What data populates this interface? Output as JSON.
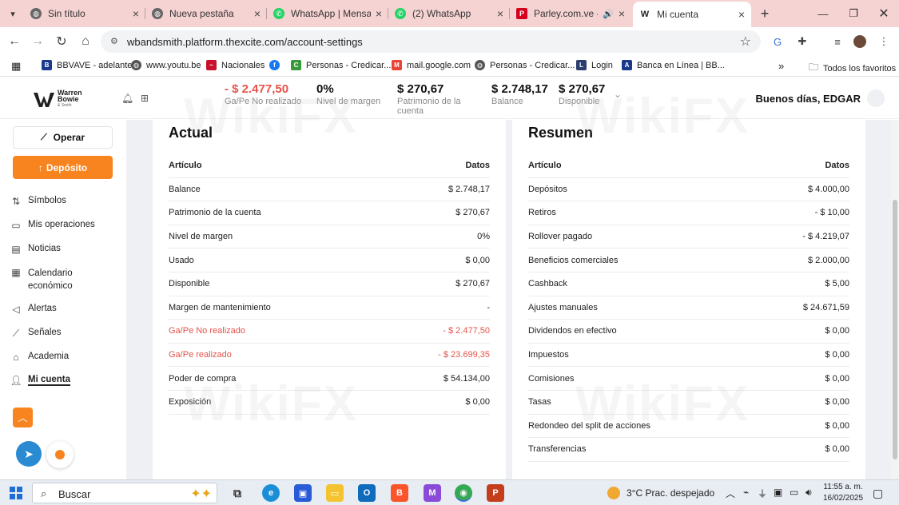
{
  "browser": {
    "tabs": [
      {
        "title": "Sin título",
        "icon": "globe-icon",
        "color": "#555555"
      },
      {
        "title": "Nueva pestaña",
        "icon": "globe-icon",
        "color": "#555555"
      },
      {
        "title": "WhatsApp | Mensaje",
        "icon": "whatsapp-icon",
        "color": "#25d366"
      },
      {
        "title": "(2) WhatsApp",
        "icon": "whatsapp-icon",
        "color": "#25d366"
      },
      {
        "title": "Parley.com.ve - El",
        "icon": "parley-icon",
        "color": "#d6001c"
      },
      {
        "title": "Mi cuenta",
        "icon": "warren-bowie-icon",
        "color": "#222222"
      }
    ],
    "url": "wbandsmith.platform.thexcite.com/account-settings",
    "bookmarks": [
      {
        "label": "BBVAVE - adelante"
      },
      {
        "label": "www.youtu.be"
      },
      {
        "label": "Nacionales"
      },
      {
        "label": ""
      },
      {
        "label": "Personas - Credicar..."
      },
      {
        "label": "mail.google.com"
      },
      {
        "label": "Personas - Credicar..."
      },
      {
        "label": "Login"
      },
      {
        "label": "Banca en Línea | BB..."
      }
    ],
    "all_bookmarks": "Todos los favoritos"
  },
  "header": {
    "brand": "Warren Bowie",
    "brand_sub": "& Smith",
    "metrics": [
      {
        "value": "- $ 2.477,50",
        "label": "Ga/Pe No realizado",
        "negative": true
      },
      {
        "value": "0%",
        "label": "Nivel de margen",
        "negative": false
      },
      {
        "value": "$ 270,67",
        "label": "Patrimonio de la cuenta",
        "negative": false
      },
      {
        "value": "$ 2.748,17",
        "label": "Balance",
        "negative": false
      },
      {
        "value": "$ 270,67",
        "label": "Disponible",
        "negative": false
      }
    ],
    "greeting": "Buenos días, EDGAR"
  },
  "sidebar": {
    "operar": "Operar",
    "deposito": "Depósito",
    "items": [
      {
        "label": "Símbolos",
        "icon": "sort-arrows-icon"
      },
      {
        "label": "Mis operaciones",
        "icon": "briefcase-icon"
      },
      {
        "label": "Noticias",
        "icon": "newspaper-icon"
      },
      {
        "label": "Calendario económico",
        "icon": "calendar-icon"
      },
      {
        "label": "Alertas",
        "icon": "megaphone-icon"
      },
      {
        "label": "Señales",
        "icon": "signal-icon"
      },
      {
        "label": "Academia",
        "icon": "graduation-cap-icon"
      },
      {
        "label": "Mi cuenta",
        "icon": "user-icon"
      }
    ]
  },
  "actual": {
    "title": "Actual",
    "col_item": "Artículo",
    "col_data": "Datos",
    "rows": [
      {
        "label": "Balance",
        "value": "$ 2.748,17",
        "red": false
      },
      {
        "label": "Patrimonio de la cuenta",
        "value": "$ 270,67",
        "red": false
      },
      {
        "label": "Nivel de margen",
        "value": "0%",
        "red": false
      },
      {
        "label": "Usado",
        "value": "$ 0,00",
        "red": false
      },
      {
        "label": "Disponible",
        "value": "$ 270,67",
        "red": false
      },
      {
        "label": "Margen de mantenimiento",
        "value": "-",
        "red": false
      },
      {
        "label": "Ga/Pe No realizado",
        "value": "- $ 2.477,50",
        "red": true
      },
      {
        "label": "Ga/Pe realizado",
        "value": "- $ 23.699,35",
        "red": true
      },
      {
        "label": "Poder de compra",
        "value": "$ 54.134,00",
        "red": false
      },
      {
        "label": "Exposición",
        "value": "$ 0,00",
        "red": false
      }
    ]
  },
  "resumen": {
    "title": "Resumen",
    "col_item": "Artículo",
    "col_data": "Datos",
    "rows": [
      {
        "label": "Depósitos",
        "value": "$ 4.000,00"
      },
      {
        "label": "Retiros",
        "value": "- $ 10,00"
      },
      {
        "label": "Rollover pagado",
        "value": "- $ 4.219,07"
      },
      {
        "label": "Beneficios comerciales",
        "value": "$ 2.000,00"
      },
      {
        "label": "Cashback",
        "value": "$ 5,00"
      },
      {
        "label": "Ajustes manuales",
        "value": "$ 24.671,59"
      },
      {
        "label": "Dividendos en efectivo",
        "value": "$ 0,00"
      },
      {
        "label": "Impuestos",
        "value": "$ 0,00"
      },
      {
        "label": "Comisiones",
        "value": "$ 0,00"
      },
      {
        "label": "Tasas",
        "value": "$ 0,00"
      },
      {
        "label": "Redondeo del split de acciones",
        "value": "$ 0,00"
      },
      {
        "label": "Transferencias",
        "value": "$ 0,00"
      }
    ]
  },
  "watermark": "WikiFX",
  "taskbar": {
    "search": "Buscar",
    "weather": "3°C  Prac. despejado",
    "time": "11:55 a. m.",
    "date": "16/02/2025"
  },
  "colors": {
    "accent": "#f7841f",
    "negative": "#e5534b",
    "tab_bar": "#f6d3d3"
  }
}
